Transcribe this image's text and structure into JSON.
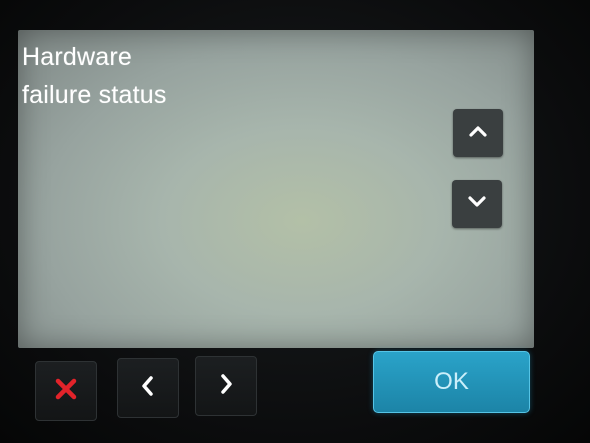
{
  "dialog": {
    "title_line1": "Hardware",
    "title_line2": "failure status"
  },
  "scroll": {
    "up_icon": "chevron-up-icon",
    "down_icon": "chevron-down-icon"
  },
  "footer": {
    "cancel_icon": "close-icon",
    "back_icon": "chevron-left-icon",
    "forward_icon": "chevron-right-icon",
    "ok_label": "OK"
  },
  "colors": {
    "cancel_red": "#e2232a",
    "ok_blue": "#1f93bb",
    "screen_bg": "#a9b7ab"
  }
}
